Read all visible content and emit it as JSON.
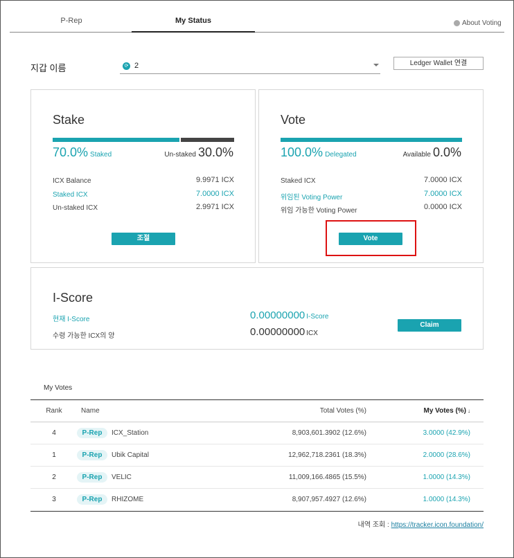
{
  "tabs": [
    {
      "label": "P-Rep"
    },
    {
      "label": "My Status"
    }
  ],
  "about_voting": "About Voting",
  "wallet": {
    "label": "지갑 이름",
    "selected": "2",
    "ledger_button": "Ledger Wallet 연결"
  },
  "stake": {
    "title": "Stake",
    "staked_pct": 70.0,
    "staked_pct_label": "70.0%",
    "staked_word": "Staked",
    "unstaked_word": "Un-staked",
    "unstaked_pct_label": "30.0%",
    "rows": [
      {
        "label": "ICX Balance",
        "value": "9.9971",
        "unit": "ICX"
      },
      {
        "label": "Staked ICX",
        "value": "7.0000",
        "unit": "ICX"
      },
      {
        "label": "Un-staked ICX",
        "value": "2.9971",
        "unit": "ICX"
      }
    ],
    "button": "조절"
  },
  "vote": {
    "title": "Vote",
    "delegated_pct": 100.0,
    "delegated_pct_label": "100.0%",
    "delegated_word": "Delegated",
    "available_word": "Available",
    "available_pct_label": "0.0%",
    "rows": [
      {
        "label": "Staked ICX",
        "value": "7.0000",
        "unit": "ICX"
      },
      {
        "label": "위임된 Voting Power",
        "value": "7.0000",
        "unit": "ICX"
      },
      {
        "label": "위임 가능한 Voting Power",
        "value": "0.0000",
        "unit": "ICX"
      }
    ],
    "button": "Vote"
  },
  "iscore": {
    "title": "I-Score",
    "current_label": "현재 I-Score",
    "current_value": "0.00000000",
    "current_unit": "I-Score",
    "receivable_label": "수령 가능한 ICX의 양",
    "receivable_value": "0.00000000",
    "receivable_unit": "ICX",
    "button": "Claim"
  },
  "my_votes": {
    "title": "My Votes",
    "columns": {
      "rank": "Rank",
      "name": "Name",
      "total": "Total Votes (%)",
      "my": "My Votes (%)"
    },
    "sort_icon": "↓",
    "rows": [
      {
        "rank": "4",
        "badge": "P-Rep",
        "name": "ICX_Station",
        "total": "8,903,601.3902 (12.6%)",
        "my": "3.0000 (42.9%)"
      },
      {
        "rank": "1",
        "badge": "P-Rep",
        "name": "Ubik Capital",
        "total": "12,962,718.2361 (18.3%)",
        "my": "2.0000 (28.6%)"
      },
      {
        "rank": "2",
        "badge": "P-Rep",
        "name": "VELIC",
        "total": "11,009,166.4865 (15.5%)",
        "my": "1.0000 (14.3%)"
      },
      {
        "rank": "3",
        "badge": "P-Rep",
        "name": "RHIZOME",
        "total": "8,907,957.4927 (12.6%)",
        "my": "1.0000 (14.3%)"
      }
    ]
  },
  "footer": {
    "label": "내역 조회 :",
    "link": "https://tracker.icon.foundation/"
  },
  "colors": {
    "accent": "#1aa3b0",
    "highlight": "#dd1111"
  }
}
